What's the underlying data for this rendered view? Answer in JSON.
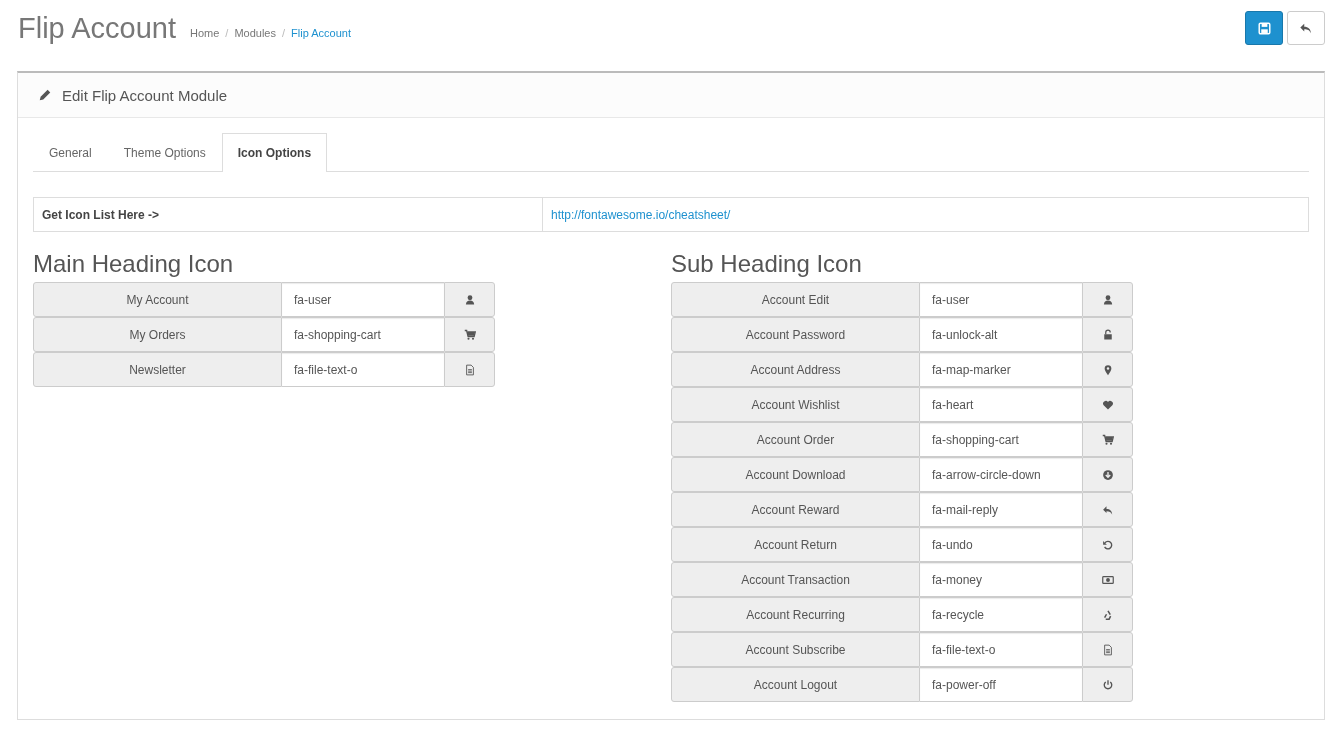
{
  "page": {
    "title": "Flip Account",
    "breadcrumb_separator": "/",
    "breadcrumb": [
      {
        "label": "Home",
        "current": false
      },
      {
        "label": "Modules",
        "current": false
      },
      {
        "label": "Flip Account",
        "current": true
      }
    ]
  },
  "panel": {
    "title": "Edit Flip Account Module"
  },
  "tabs": [
    {
      "label": "General",
      "selected": false
    },
    {
      "label": "Theme Options",
      "selected": false
    },
    {
      "label": "Icon Options",
      "selected": true
    }
  ],
  "icon_list": {
    "label": "Get Icon List Here ->",
    "link": "http://fontawesome.io/cheatsheet/"
  },
  "sections": [
    {
      "heading": "Main Heading Icon",
      "rows": [
        {
          "label": "My Account",
          "value": "fa-user",
          "kind": "user"
        },
        {
          "label": "My Orders",
          "value": "fa-shopping-cart",
          "kind": "cart"
        },
        {
          "label": "Newsletter",
          "value": "fa-file-text-o",
          "kind": "file"
        }
      ]
    },
    {
      "heading": "Sub Heading Icon",
      "rows": [
        {
          "label": "Account Edit",
          "value": "fa-user",
          "kind": "user"
        },
        {
          "label": "Account Password",
          "value": "fa-unlock-alt",
          "kind": "unlock"
        },
        {
          "label": "Account Address",
          "value": "fa-map-marker",
          "kind": "marker"
        },
        {
          "label": "Account Wishlist",
          "value": "fa-heart",
          "kind": "heart"
        },
        {
          "label": "Account Order",
          "value": "fa-shopping-cart",
          "kind": "cart"
        },
        {
          "label": "Account Download",
          "value": "fa-arrow-circle-down",
          "kind": "arrowdown"
        },
        {
          "label": "Account Reward",
          "value": "fa-mail-reply",
          "kind": "reply"
        },
        {
          "label": "Account Return",
          "value": "fa-undo",
          "kind": "undo"
        },
        {
          "label": "Account Transaction",
          "value": "fa-money",
          "kind": "money"
        },
        {
          "label": "Account Recurring",
          "value": "fa-recycle",
          "kind": "recycle"
        },
        {
          "label": "Account Subscribe",
          "value": "fa-file-text-o",
          "kind": "file"
        },
        {
          "label": "Account Logout",
          "value": "fa-power-off",
          "kind": "power"
        }
      ]
    }
  ]
}
